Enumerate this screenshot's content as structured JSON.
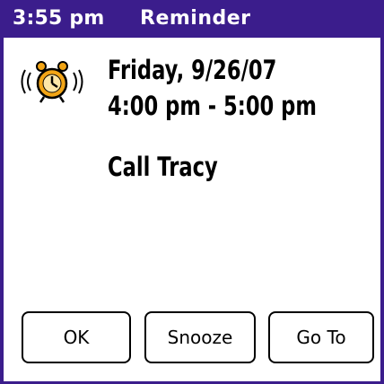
{
  "titlebar": {
    "time": "3:55 pm",
    "title": "Reminder"
  },
  "reminder": {
    "date": "Friday, 9/26/07",
    "time_range": "4:00 pm - 5:00 pm",
    "subject": "Call Tracy",
    "icon": "alarm-clock-icon"
  },
  "buttons": {
    "ok": "OK",
    "snooze": "Snooze",
    "goto": "Go To"
  },
  "colors": {
    "titlebar": "#3b1d8c",
    "alarm_fill": "#f2a516"
  }
}
